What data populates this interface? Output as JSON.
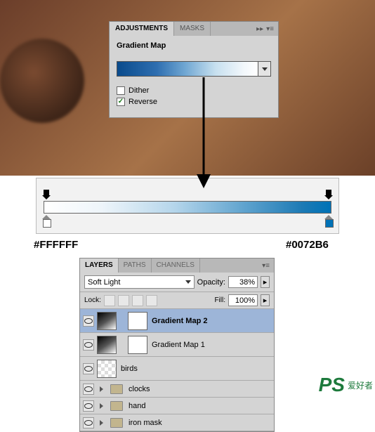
{
  "adjustments": {
    "tab_active": "ADJUSTMENTS",
    "tab_inactive": "MASKS",
    "title": "Gradient Map",
    "dither": "Dither",
    "reverse": "Reverse"
  },
  "hex": {
    "left": "#FFFFFF",
    "right": "#0072B6"
  },
  "layers": {
    "tab_layers": "LAYERS",
    "tab_paths": "PATHS",
    "tab_channels": "CHANNELS",
    "blend_mode": "Soft Light",
    "opacity_label": "Opacity:",
    "opacity_value": "38%",
    "lock_label": "Lock:",
    "fill_label": "Fill:",
    "fill_value": "100%",
    "items": {
      "gm2": "Gradient Map 2",
      "gm1": "Gradient Map 1",
      "birds": "birds",
      "clocks": "clocks",
      "hand": "hand",
      "ironmask": "iron mask"
    }
  },
  "watermark": {
    "ps": "PS",
    "cn": "爱好者"
  }
}
